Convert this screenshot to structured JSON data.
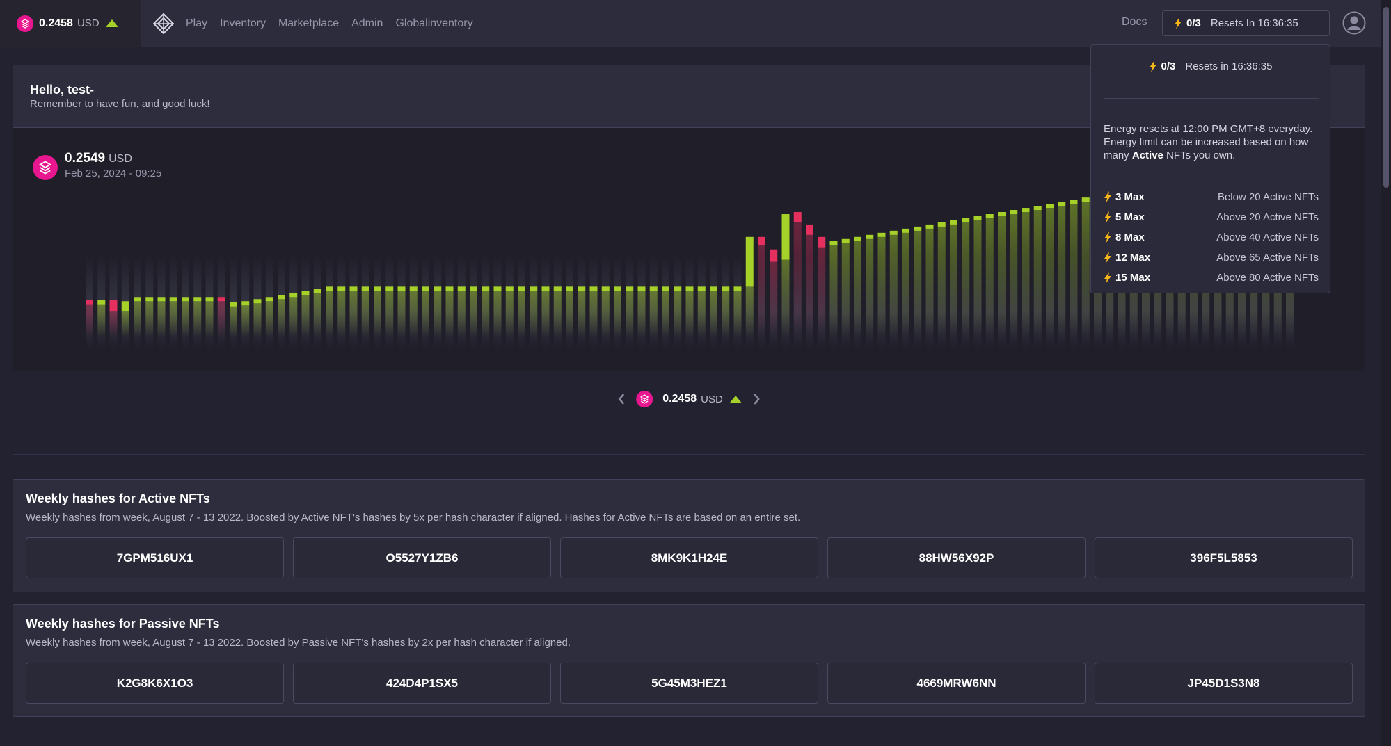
{
  "topbar": {
    "price": "0.2458",
    "unit": "USD",
    "nav": [
      "Play",
      "Inventory",
      "Marketplace",
      "Admin",
      "Globalinventory"
    ],
    "docs": "Docs",
    "energy_count": "0/3",
    "energy_reset": "Resets In 16:36:35"
  },
  "hello": {
    "title": "Hello, test-",
    "subtitle": "Remember to have fun, and good luck!"
  },
  "chart_header": {
    "price": "0.2549",
    "unit": "USD",
    "date": "Feb 25, 2024 - 09:25"
  },
  "pager": {
    "price": "0.2458",
    "unit": "USD"
  },
  "tooltip": {
    "count": "0/3",
    "reset": "Resets in 16:36:35",
    "desc_pre": "Energy resets at 12:00 PM GMT+8 everyday. Energy limit can be increased based on how many ",
    "desc_bold": "Active",
    "desc_post": " NFTs you own.",
    "tiers": [
      {
        "max": "3 Max",
        "req": "Below 20 Active NFTs"
      },
      {
        "max": "5 Max",
        "req": "Above 20 Active NFTs"
      },
      {
        "max": "8 Max",
        "req": "Above 40 Active NFTs"
      },
      {
        "max": "12 Max",
        "req": "Above 65 Active NFTs"
      },
      {
        "max": "15 Max",
        "req": "Above 80 Active NFTs"
      }
    ]
  },
  "active_hashes": {
    "title": "Weekly hashes for Active NFTs",
    "desc": "Weekly hashes from week, August 7 - 13 2022. Boosted by Active NFT's hashes by 5x per hash character if aligned. Hashes for Active NFTs are based on an entire set.",
    "items": [
      "7GPM516UX1",
      "O5527Y1ZB6",
      "8MK9K1H24E",
      "88HW56X92P",
      "396F5L5853"
    ]
  },
  "passive_hashes": {
    "title": "Weekly hashes for Passive NFTs",
    "desc": "Weekly hashes from week, August 7 - 13 2022. Boosted by Passive NFT's hashes by 2x per hash character if aligned.",
    "items": [
      "K2G8K6X1O3",
      "424D4P1SX5",
      "5G45M3HEZ1",
      "4669MRW6NN",
      "JP45D1S3N8"
    ]
  },
  "chart_data": {
    "type": "bar",
    "style": "candlestick",
    "colors": {
      "up": "#a6d128",
      "down": "#e5305f"
    },
    "candles": [
      {
        "open": 0.05,
        "close": 0.05,
        "dir": "down"
      },
      {
        "open": 0.05,
        "close": 0.05,
        "dir": "up"
      },
      {
        "open": 0.055,
        "close": 0.032,
        "dir": "down"
      },
      {
        "open": 0.032,
        "close": 0.052,
        "dir": "up"
      },
      {
        "open": 0.056,
        "close": 0.056,
        "dir": "up"
      },
      {
        "open": 0.056,
        "close": 0.056,
        "dir": "up"
      },
      {
        "open": 0.056,
        "close": 0.056,
        "dir": "up"
      },
      {
        "open": 0.056,
        "close": 0.056,
        "dir": "up"
      },
      {
        "open": 0.056,
        "close": 0.056,
        "dir": "up"
      },
      {
        "open": 0.056,
        "close": 0.056,
        "dir": "up"
      },
      {
        "open": 0.056,
        "close": 0.056,
        "dir": "up"
      },
      {
        "open": 0.056,
        "close": 0.05,
        "dir": "down"
      },
      {
        "open": 0.046,
        "close": 0.046,
        "dir": "up"
      },
      {
        "open": 0.048,
        "close": 0.048,
        "dir": "up"
      },
      {
        "open": 0.052,
        "close": 0.052,
        "dir": "up"
      },
      {
        "open": 0.056,
        "close": 0.056,
        "dir": "up"
      },
      {
        "open": 0.06,
        "close": 0.06,
        "dir": "up"
      },
      {
        "open": 0.064,
        "close": 0.064,
        "dir": "up"
      },
      {
        "open": 0.068,
        "close": 0.068,
        "dir": "up"
      },
      {
        "open": 0.072,
        "close": 0.072,
        "dir": "up"
      },
      {
        "open": 0.076,
        "close": 0.076,
        "dir": "up"
      },
      {
        "open": 0.076,
        "close": 0.076,
        "dir": "up"
      },
      {
        "open": 0.076,
        "close": 0.076,
        "dir": "up"
      },
      {
        "open": 0.076,
        "close": 0.076,
        "dir": "up"
      },
      {
        "open": 0.076,
        "close": 0.076,
        "dir": "up"
      },
      {
        "open": 0.076,
        "close": 0.076,
        "dir": "up"
      },
      {
        "open": 0.076,
        "close": 0.076,
        "dir": "up"
      },
      {
        "open": 0.076,
        "close": 0.076,
        "dir": "up"
      },
      {
        "open": 0.076,
        "close": 0.076,
        "dir": "up"
      },
      {
        "open": 0.076,
        "close": 0.076,
        "dir": "up"
      },
      {
        "open": 0.076,
        "close": 0.076,
        "dir": "up"
      },
      {
        "open": 0.076,
        "close": 0.076,
        "dir": "up"
      },
      {
        "open": 0.076,
        "close": 0.076,
        "dir": "up"
      },
      {
        "open": 0.076,
        "close": 0.076,
        "dir": "up"
      },
      {
        "open": 0.076,
        "close": 0.076,
        "dir": "up"
      },
      {
        "open": 0.076,
        "close": 0.076,
        "dir": "up"
      },
      {
        "open": 0.076,
        "close": 0.076,
        "dir": "up"
      },
      {
        "open": 0.076,
        "close": 0.076,
        "dir": "up"
      },
      {
        "open": 0.076,
        "close": 0.076,
        "dir": "up"
      },
      {
        "open": 0.076,
        "close": 0.076,
        "dir": "up"
      },
      {
        "open": 0.076,
        "close": 0.076,
        "dir": "up"
      },
      {
        "open": 0.076,
        "close": 0.076,
        "dir": "up"
      },
      {
        "open": 0.076,
        "close": 0.076,
        "dir": "up"
      },
      {
        "open": 0.076,
        "close": 0.076,
        "dir": "up"
      },
      {
        "open": 0.076,
        "close": 0.076,
        "dir": "up"
      },
      {
        "open": 0.076,
        "close": 0.076,
        "dir": "up"
      },
      {
        "open": 0.076,
        "close": 0.076,
        "dir": "up"
      },
      {
        "open": 0.076,
        "close": 0.076,
        "dir": "up"
      },
      {
        "open": 0.076,
        "close": 0.076,
        "dir": "up"
      },
      {
        "open": 0.076,
        "close": 0.076,
        "dir": "up"
      },
      {
        "open": 0.076,
        "close": 0.076,
        "dir": "up"
      },
      {
        "open": 0.076,
        "close": 0.076,
        "dir": "up"
      },
      {
        "open": 0.076,
        "close": 0.076,
        "dir": "up"
      },
      {
        "open": 0.076,
        "close": 0.076,
        "dir": "up"
      },
      {
        "open": 0.076,
        "close": 0.076,
        "dir": "up"
      },
      {
        "open": 0.08,
        "close": 0.176,
        "dir": "up"
      },
      {
        "open": 0.176,
        "close": 0.16,
        "dir": "down"
      },
      {
        "open": 0.152,
        "close": 0.128,
        "dir": "down"
      },
      {
        "open": 0.132,
        "close": 0.22,
        "dir": "up"
      },
      {
        "open": 0.224,
        "close": 0.204,
        "dir": "down"
      },
      {
        "open": 0.2,
        "close": 0.18,
        "dir": "down"
      },
      {
        "open": 0.176,
        "close": 0.156,
        "dir": "down"
      },
      {
        "open": 0.164,
        "close": 0.164,
        "dir": "up"
      },
      {
        "open": 0.168,
        "close": 0.168,
        "dir": "up"
      },
      {
        "open": 0.172,
        "close": 0.172,
        "dir": "up"
      },
      {
        "open": 0.176,
        "close": 0.176,
        "dir": "up"
      },
      {
        "open": 0.18,
        "close": 0.18,
        "dir": "up"
      },
      {
        "open": 0.184,
        "close": 0.184,
        "dir": "up"
      },
      {
        "open": 0.188,
        "close": 0.188,
        "dir": "up"
      },
      {
        "open": 0.192,
        "close": 0.192,
        "dir": "up"
      },
      {
        "open": 0.196,
        "close": 0.196,
        "dir": "up"
      },
      {
        "open": 0.2,
        "close": 0.2,
        "dir": "up"
      },
      {
        "open": 0.204,
        "close": 0.204,
        "dir": "up"
      },
      {
        "open": 0.208,
        "close": 0.208,
        "dir": "up"
      },
      {
        "open": 0.212,
        "close": 0.212,
        "dir": "up"
      },
      {
        "open": 0.216,
        "close": 0.216,
        "dir": "up"
      },
      {
        "open": 0.22,
        "close": 0.22,
        "dir": "up"
      },
      {
        "open": 0.224,
        "close": 0.224,
        "dir": "up"
      },
      {
        "open": 0.228,
        "close": 0.228,
        "dir": "up"
      },
      {
        "open": 0.232,
        "close": 0.232,
        "dir": "up"
      },
      {
        "open": 0.236,
        "close": 0.236,
        "dir": "up"
      },
      {
        "open": 0.24,
        "close": 0.24,
        "dir": "up"
      },
      {
        "open": 0.244,
        "close": 0.244,
        "dir": "up"
      },
      {
        "open": 0.248,
        "close": 0.248,
        "dir": "up"
      },
      {
        "open": 0.252,
        "close": 0.252,
        "dir": "up"
      },
      {
        "open": 0.2549,
        "close": 0.2549,
        "dir": "up"
      },
      {
        "open": 0.2549,
        "close": 0.2549,
        "dir": "up"
      },
      {
        "open": 0.2549,
        "close": 0.2549,
        "dir": "up"
      },
      {
        "open": 0.2549,
        "close": 0.2549,
        "dir": "up"
      },
      {
        "open": 0.2549,
        "close": 0.2549,
        "dir": "up"
      },
      {
        "open": 0.2549,
        "close": 0.2549,
        "dir": "up"
      },
      {
        "open": 0.2549,
        "close": 0.2549,
        "dir": "up"
      },
      {
        "open": 0.2549,
        "close": 0.2549,
        "dir": "up"
      },
      {
        "open": 0.2549,
        "close": 0.2549,
        "dir": "up"
      },
      {
        "open": 0.2549,
        "close": 0.2549,
        "dir": "up"
      },
      {
        "open": 0.2549,
        "close": 0.2549,
        "dir": "up"
      },
      {
        "open": 0.2549,
        "close": 0.2549,
        "dir": "up"
      },
      {
        "open": 0.2549,
        "close": 0.2549,
        "dir": "up"
      },
      {
        "open": 0.2549,
        "close": 0.2549,
        "dir": "up"
      },
      {
        "open": 0.2549,
        "close": 0.2549,
        "dir": "up"
      },
      {
        "open": 0.2549,
        "close": 0.2549,
        "dir": "up"
      }
    ]
  }
}
